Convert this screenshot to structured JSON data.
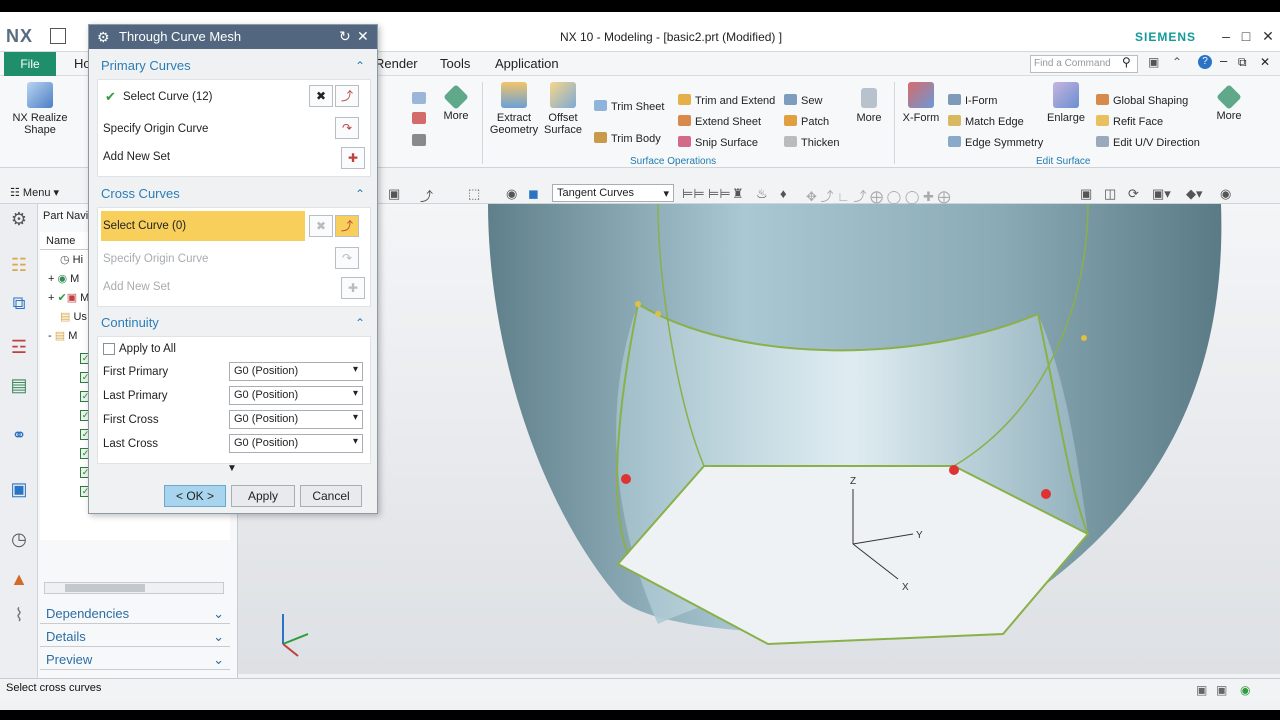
{
  "app": {
    "logo": "NX",
    "title": "NX 10 - Modeling - [basic2.prt (Modified) ]",
    "brand": "SIEMENS"
  },
  "menu": {
    "file": "File",
    "home": "Ho",
    "render": "Render",
    "tools": "Tools",
    "application": "Application",
    "search_placeholder": "Find a Command"
  },
  "ribbon": {
    "realize_shape": "NX Realize Shape",
    "more1": "More",
    "extract_geometry": "Extract Geometry",
    "offset_surface": "Offset Surface",
    "trim_sheet": "Trim Sheet",
    "trim_body": "Trim Body",
    "trim_and_extend": "Trim and Extend",
    "extend_sheet": "Extend Sheet",
    "snip_surface": "Snip Surface",
    "sew": "Sew",
    "patch": "Patch",
    "thicken": "Thicken",
    "more2": "More",
    "group_surface_ops": "Surface Operations",
    "xform": "X-Form",
    "iform": "I-Form",
    "match_edge": "Match Edge",
    "edge_symmetry": "Edge Symmetry",
    "enlarge": "Enlarge",
    "global_shaping": "Global Shaping",
    "refit_face": "Refit Face",
    "edit_uv": "Edit U/V Direction",
    "more3": "More",
    "group_edit_surface": "Edit Surface"
  },
  "toolbar": {
    "menu": "Menu",
    "tangent_curves": "Tangent Curves"
  },
  "navigator": {
    "title": "Part Navi",
    "col_name": "Name",
    "nodes": [
      "Hi",
      "M",
      "M",
      "Us",
      "M"
    ],
    "dependencies": "Dependencies",
    "details": "Details",
    "preview": "Preview"
  },
  "dialog": {
    "title": "Through Curve Mesh",
    "primary": {
      "header": "Primary Curves",
      "select_curve": "Select Curve (12)",
      "specify_origin": "Specify Origin Curve",
      "add_new_set": "Add New Set"
    },
    "cross": {
      "header": "Cross Curves",
      "select_curve": "Select Curve (0)",
      "specify_origin": "Specify Origin Curve",
      "add_new_set": "Add New Set"
    },
    "continuity": {
      "header": "Continuity",
      "apply_to_all": "Apply to All",
      "first_primary": "First Primary",
      "last_primary": "Last Primary",
      "first_cross": "First Cross",
      "last_cross": "Last Cross",
      "first_primary_value": "G0 (Position)",
      "last_primary_value": "G0 (Position)",
      "first_cross_value": "G0 (Position)",
      "last_cross_value": "G0 (Position)"
    },
    "ok": "< OK >",
    "apply": "Apply",
    "cancel": "Cancel"
  },
  "status": {
    "text": "Select cross curves"
  },
  "colors": {
    "accent": "#1e8f6a",
    "dialog_title": "#52677f",
    "highlight": "#f7cf5a",
    "surface": "#7fa3b0"
  }
}
